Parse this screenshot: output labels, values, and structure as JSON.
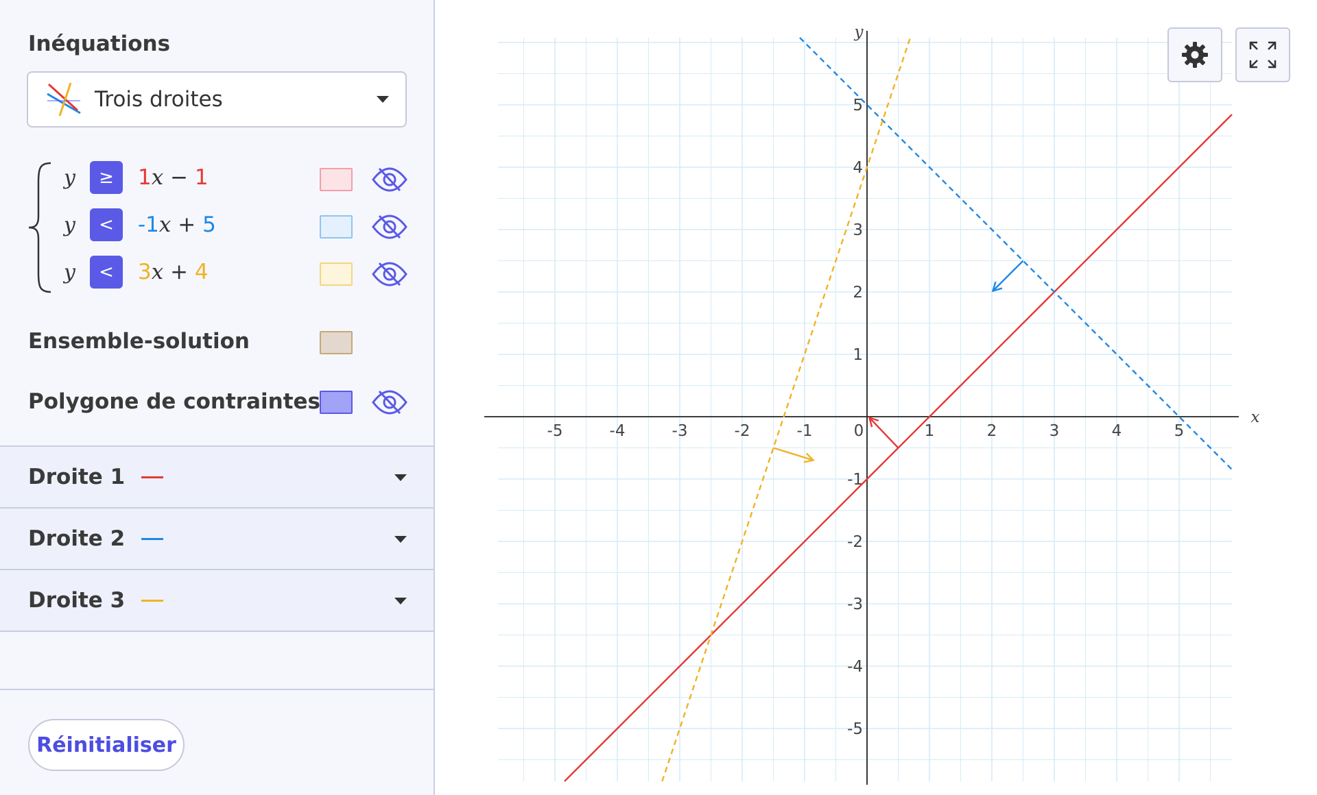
{
  "sidebar": {
    "title": "Inéquations",
    "preset": {
      "label": "Trois droites",
      "icon": "three-lines-icon"
    },
    "inequalities": [
      {
        "y": "y",
        "operator": "≥",
        "coef": "1",
        "x": "x",
        "sign": " − ",
        "const": "1",
        "color": "#e53935",
        "fill": "#fce4e6",
        "border": "#f2a0a6"
      },
      {
        "y": "y",
        "operator": "<",
        "coef": "-1",
        "x": "x",
        "sign": " + ",
        "const": "5",
        "color": "#1e88e5",
        "fill": "#e4f1fc",
        "border": "#8ec5ef"
      },
      {
        "y": "y",
        "operator": "<",
        "coef": "3",
        "x": "x",
        "sign": " + ",
        "const": "4",
        "color": "#f0b323",
        "fill": "#fdf5dc",
        "border": "#f3d681"
      }
    ],
    "solution_set": {
      "label": "Ensemble-solution",
      "fill": "#e3d8cd",
      "border": "#c4a97a"
    },
    "polygon": {
      "label": "Polygone de contraintes",
      "fill": "#a2a2f6",
      "border": "#5a5ae6"
    },
    "droites": [
      {
        "label": "Droite 1",
        "color": "#e53935"
      },
      {
        "label": "Droite 2",
        "color": "#1e88e5"
      },
      {
        "label": "Droite 3",
        "color": "#f0b323"
      }
    ],
    "reset_label": "Réinitialiser"
  },
  "graph": {
    "toolbar": {
      "settings_icon": "gear-icon",
      "fullscreen_icon": "expand-icon"
    },
    "x_axis_label": "x",
    "y_axis_label": "y",
    "x_ticks": [
      "-5",
      "-4",
      "-3",
      "-2",
      "-1",
      "0",
      "1",
      "2",
      "3",
      "4",
      "5"
    ],
    "y_ticks": [
      "5",
      "4",
      "3",
      "2",
      "1",
      "-1",
      "-2",
      "-3",
      "-4",
      "-5"
    ],
    "lines": [
      {
        "name": "Droite 1",
        "slope": 1,
        "intercept": -1,
        "style": "solid",
        "color": "#e53935",
        "arrow_direction": "up-left"
      },
      {
        "name": "Droite 2",
        "slope": -1,
        "intercept": 5,
        "style": "dashed",
        "color": "#1e88e5",
        "arrow_direction": "down-left"
      },
      {
        "name": "Droite 3",
        "slope": 3,
        "intercept": 4,
        "style": "dashed",
        "color": "#f0b323",
        "arrow_direction": "right"
      }
    ]
  }
}
